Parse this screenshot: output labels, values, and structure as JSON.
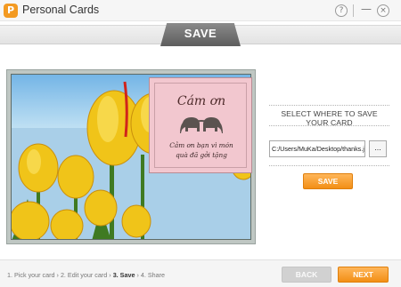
{
  "window": {
    "title": "Personal Cards",
    "logo_glyph": "P",
    "help_glyph": "?",
    "minimize_glyph": "—",
    "close_glyph": "×"
  },
  "header": {
    "step_title": "SAVE"
  },
  "card": {
    "title": "Cám ơn",
    "message_line1": "Cảm ơn bạn vì món",
    "message_line2": "quà đã gởi tặng",
    "icon": "elephants-icon"
  },
  "save_panel": {
    "label": "SELECT WHERE TO SAVE YOUR CARD",
    "path_value": "C:/Users/MuKa/Desktop/thanks.jpg",
    "browse_label": "...",
    "save_button": "SAVE"
  },
  "footer": {
    "steps": [
      "1. Pick your card",
      "2. Edit your card",
      "3. Save",
      "4. Share"
    ],
    "separator": "›",
    "back_button": "BACK",
    "next_button": "NEXT"
  },
  "colors": {
    "accent": "#f39a22",
    "card_pink": "#f2c7cf",
    "disabled": "#d1d1d1"
  }
}
